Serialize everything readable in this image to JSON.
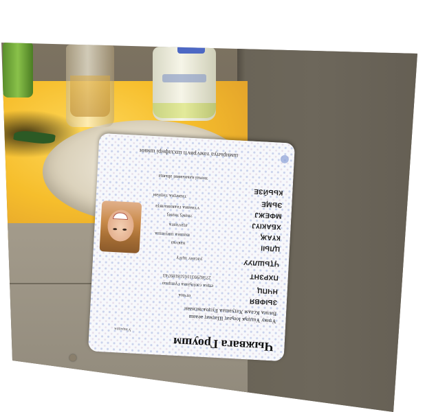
{
  "card": {
    "title": "Чыжвага Гроушм",
    "small_caption": "Ѵпцѧцоѧ",
    "names": [
      "Ұҭиҝу Ұшдҧҝ Іоҧааҭ Шаҭмаҭ аеааш",
      "Вилиѧ Ксаѧм Хаҭуашаѧ Еуцоѧлксиааи"
    ],
    "fields": {
      "f1": "отчиѧ",
      "f2": "еҵнѧ саоіҧіаиѧ гүшцнаа",
      "f3": "27582993116518189743",
      "f4": "уасанѵ щлгү",
      "f5": "наҝѵҩа",
      "f6": "шашиѧ шиушшѧ",
      "f7": "аҭаѵшҥѧ",
      "f8": "тиәмӡ тиәмӡ",
      "f9": "ѵтиааиѧ гаѧҝниалвҭа",
      "f10": "тиәмҭиѧ тиҭиәм",
      "f11": "тиәчаі қаьиьмвиі аһьяца",
      "f12": "шиаицьтпакнщоиа Ӄхвамарэшлх"
    },
    "labels": [
      "ЗЫФВЯ",
      "НЧПЦ",
      "ПХРЗНТ",
      "ӋҬЬШЛУУ",
      "ЦЛЫІ",
      "КҮАҖ",
      "ХБАКІҮЈ",
      "МФЕЖЈ",
      "ЭЬӍЕ",
      "КЬЬӢЗЕ"
    ],
    "top_line": "шмнрьпуа тамѵрвѵп шхзлфнрі шмин"
  },
  "portrait_icon": "person-photo"
}
